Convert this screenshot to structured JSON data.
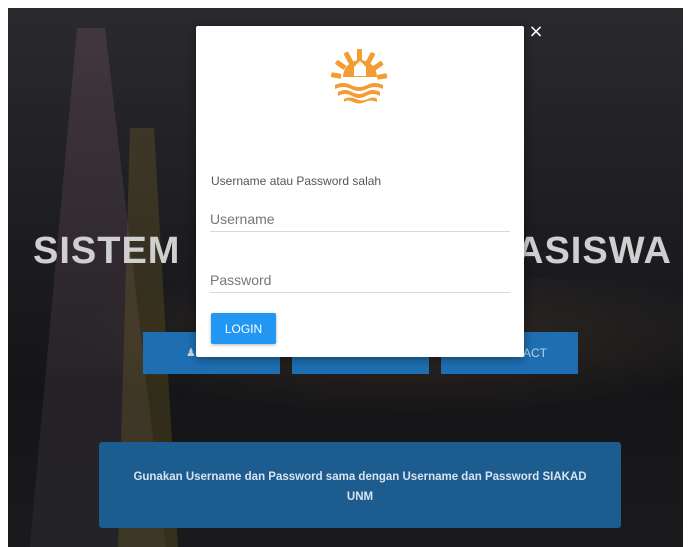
{
  "background": {
    "title_left": "SISTEM",
    "title_right": "ASISWA",
    "buttons": [
      {
        "icon": "user-icon",
        "label": ""
      },
      {
        "label": ""
      },
      {
        "label": "ACT"
      }
    ],
    "notice": "Gunakan Username dan Password sama dengan Username dan Password SIAKAD UNM"
  },
  "modal": {
    "close_symbol": "×",
    "logo": "university-logo-icon",
    "error_message": "Username atau Password salah",
    "username": {
      "placeholder": "Username",
      "value": ""
    },
    "password": {
      "placeholder": "Password",
      "value": ""
    },
    "login_label": "LOGIN"
  },
  "colors": {
    "accent": "#2196f3",
    "hero_button": "#1e6fb2",
    "notice_bg": "#1d5c8f",
    "logo": "#f39c33"
  }
}
